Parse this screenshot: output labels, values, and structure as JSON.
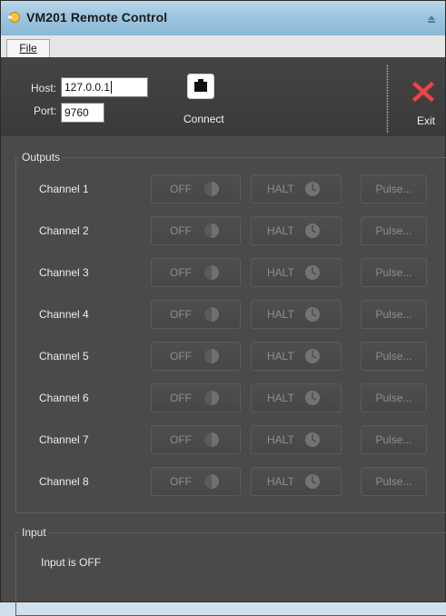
{
  "window": {
    "title": "VM201 Remote Control"
  },
  "menu": {
    "file_label": "File"
  },
  "connection": {
    "host_label": "Host:",
    "host_value": "127.0.0.1",
    "port_label": "Port:",
    "port_value": "9760",
    "connect_label": "Connect",
    "exit_label": "Exit"
  },
  "outputs": {
    "group_title": "Outputs",
    "off_label": "OFF",
    "halt_label": "HALT",
    "pulse_label": "Pulse...",
    "channels": [
      {
        "label": "Channel 1"
      },
      {
        "label": "Channel 2"
      },
      {
        "label": "Channel 3"
      },
      {
        "label": "Channel 4"
      },
      {
        "label": "Channel 5"
      },
      {
        "label": "Channel 6"
      },
      {
        "label": "Channel 7"
      },
      {
        "label": "Channel 8"
      }
    ]
  },
  "input": {
    "group_title": "Input",
    "status": "Input is OFF"
  },
  "colors": {
    "accent_exit": "#e8474a",
    "window_bg": "#4a4a4a",
    "title_bar": "#9ec6e0"
  },
  "icons": {
    "app": "app-icon",
    "connect": "network-port-icon",
    "exit": "close-x-icon",
    "off_state": "half-circle-icon",
    "halt_state": "clock-icon"
  }
}
